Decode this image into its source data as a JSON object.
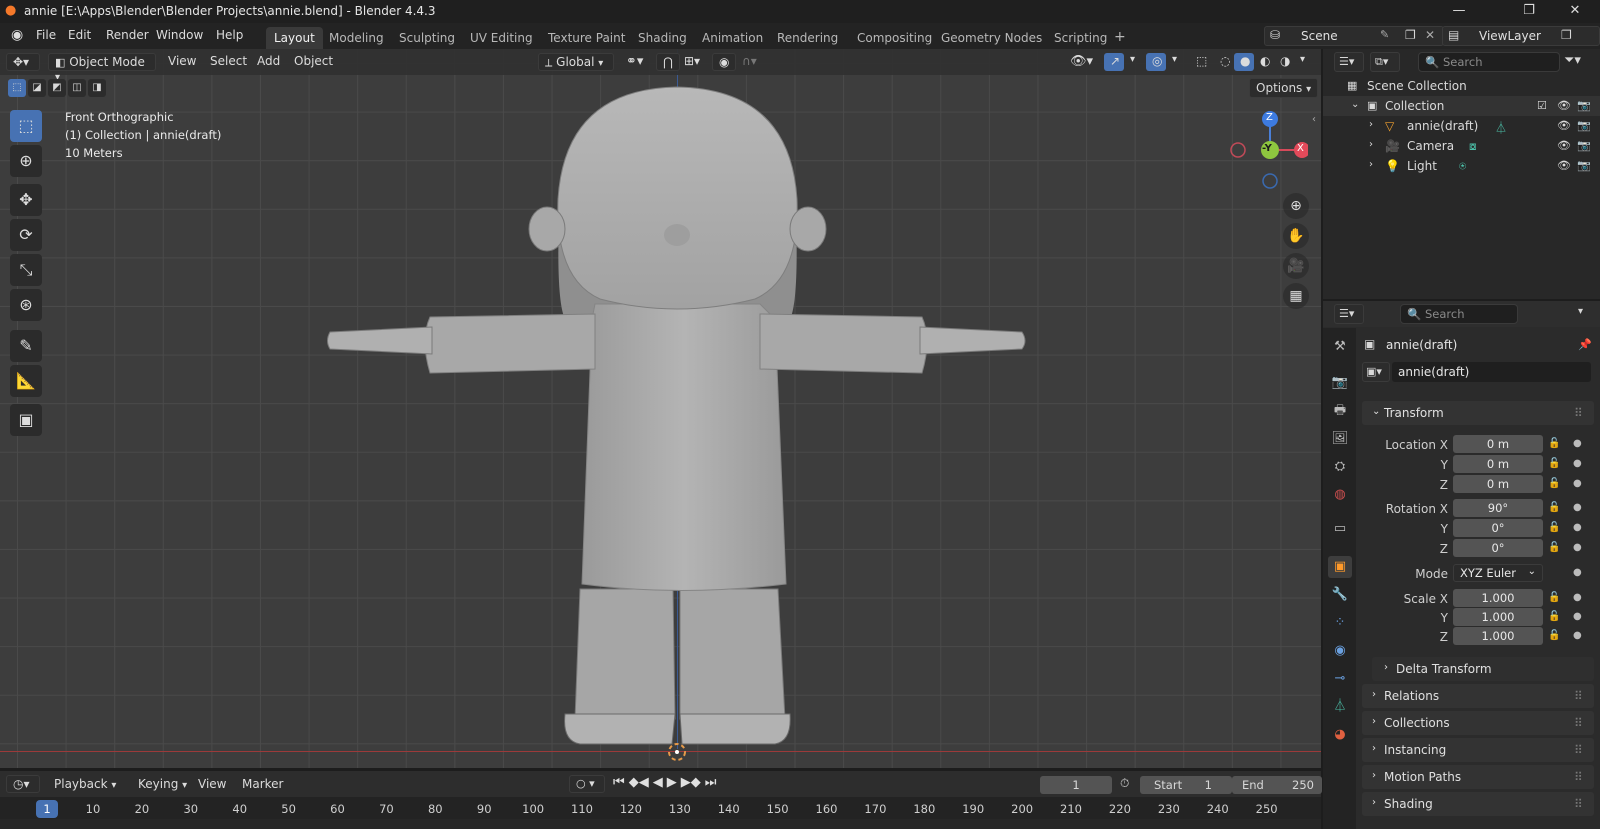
{
  "window": {
    "title": "annie [E:\\Apps\\Blender\\Blender Projects\\annie.blend] - Blender 4.4.3",
    "minimize": "—",
    "maximize": "❐",
    "close": "✕"
  },
  "menu": [
    "File",
    "Edit",
    "Render",
    "Window",
    "Help"
  ],
  "workspaces": [
    {
      "label": "Layout",
      "active": true
    },
    {
      "label": "Modeling"
    },
    {
      "label": "Sculpting"
    },
    {
      "label": "UV Editing"
    },
    {
      "label": "Texture Paint"
    },
    {
      "label": "Shading"
    },
    {
      "label": "Animation"
    },
    {
      "label": "Rendering"
    },
    {
      "label": "Compositing"
    },
    {
      "label": "Geometry Nodes"
    },
    {
      "label": "Scripting"
    }
  ],
  "add_workspace": "+",
  "scene": {
    "label": "Scene",
    "viewlayer": "ViewLayer"
  },
  "viewport": {
    "mode": "Object Mode",
    "menus": [
      "View",
      "Select",
      "Add",
      "Object"
    ],
    "transform_orientation": "Global",
    "options": "Options",
    "view_name": "Front Orthographic",
    "collection_info": "(1) Collection | annie(draft)",
    "scale_info": "10 Meters",
    "gizmo": {
      "z": "Z",
      "y": "-Y",
      "x": "X"
    }
  },
  "outliner": {
    "search_placeholder": "Search",
    "scene_collection": "Scene Collection",
    "collection": "Collection",
    "items": [
      "annie(draft)",
      "Camera",
      "Light"
    ]
  },
  "properties": {
    "search_placeholder": "Search",
    "object_name": "annie(draft)",
    "object_name_field": "annie(draft)",
    "transform_header": "Transform",
    "location_label": "Location X",
    "rotation_label": "Rotation X",
    "scale_label": "Scale X",
    "y_label": "Y",
    "z_label": "Z",
    "location": {
      "x": "0 m",
      "y": "0 m",
      "z": "0 m"
    },
    "rotation": {
      "x": "90°",
      "y": "0°",
      "z": "0°"
    },
    "mode_label": "Mode",
    "mode_value": "XYZ Euler",
    "scale": {
      "x": "1.000",
      "y": "1.000",
      "z": "1.000"
    },
    "delta": "Delta Transform",
    "panels": [
      "Relations",
      "Collections",
      "Instancing",
      "Motion Paths",
      "Shading"
    ]
  },
  "timeline": {
    "menus": [
      "Playback",
      "Keying",
      "View",
      "Marker"
    ],
    "current_frame": "1",
    "start_label": "Start",
    "start": "1",
    "end_label": "End",
    "end": "250",
    "ticks": [
      "1",
      "10",
      "20",
      "30",
      "40",
      "50",
      "60",
      "70",
      "80",
      "90",
      "100",
      "110",
      "120",
      "130",
      "140",
      "150",
      "160",
      "170",
      "180",
      "190",
      "200",
      "210",
      "220",
      "230",
      "240",
      "250"
    ]
  }
}
